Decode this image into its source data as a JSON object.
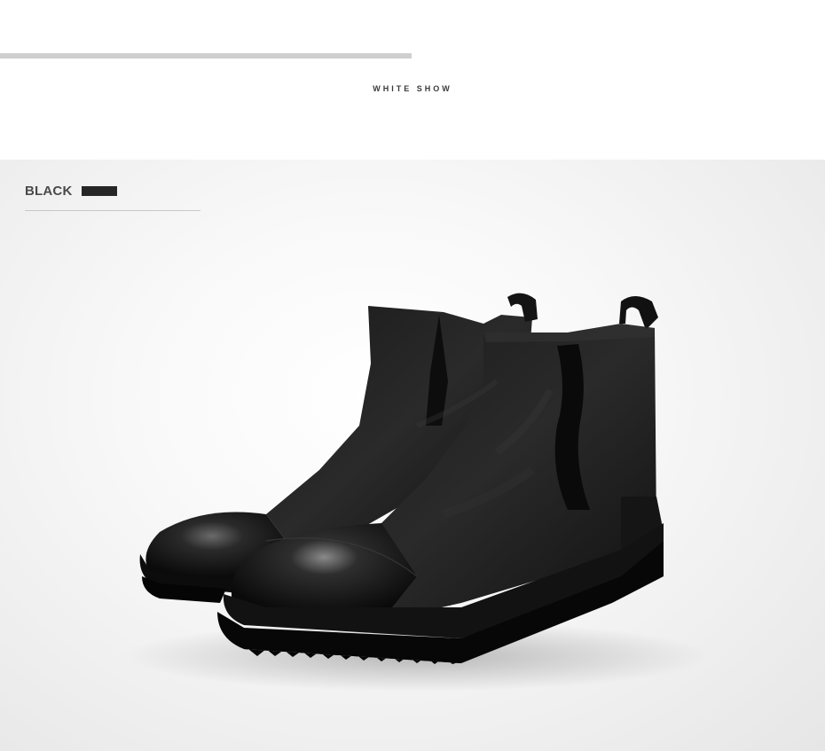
{
  "header": {
    "title": "WHITE SHOW"
  },
  "product_photo": {
    "color_label": "BLACK",
    "swatch_color": "#262626",
    "subject": "pair of black leather chelsea boots"
  }
}
